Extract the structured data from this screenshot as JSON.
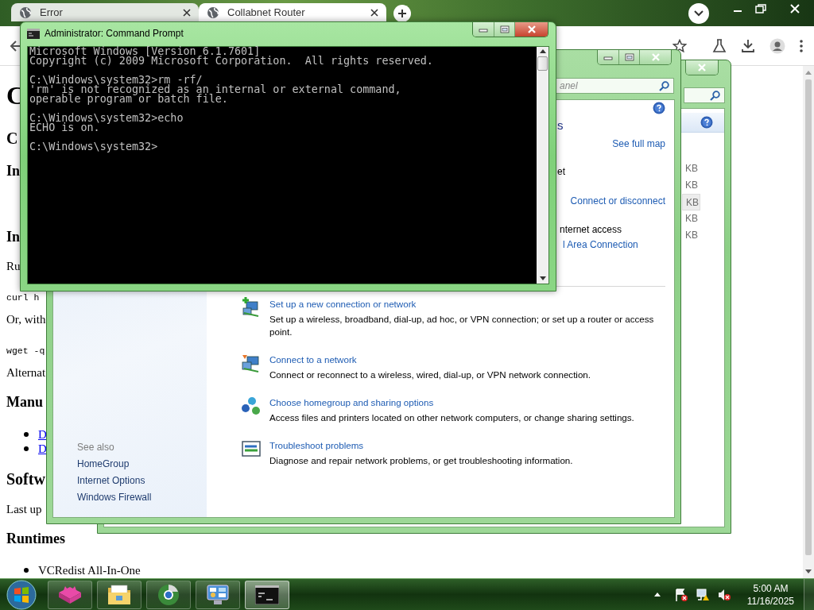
{
  "browser": {
    "tabs": [
      {
        "title": "Error",
        "selected": false
      },
      {
        "title": "Collabnet Router",
        "selected": true
      }
    ],
    "page": [
      {
        "kind": "h1",
        "text": "C"
      },
      {
        "kind": "h2",
        "text": "C"
      },
      {
        "kind": "h3",
        "text": "In"
      },
      {
        "kind": "h3",
        "text": "In"
      },
      {
        "kind": "p",
        "text": "Ru"
      },
      {
        "kind": "code",
        "text": "curl h"
      },
      {
        "kind": "p",
        "text": "Or, with"
      },
      {
        "kind": "code",
        "text": "wget -q"
      },
      {
        "kind": "p",
        "text": "Alternat"
      },
      {
        "kind": "h3",
        "text": "Manu"
      },
      {
        "kind": "link_item",
        "text": "D"
      },
      {
        "kind": "link_item",
        "text": "D"
      },
      {
        "kind": "h2",
        "text": "Softw"
      },
      {
        "kind": "p",
        "text": "Last up"
      },
      {
        "kind": "h3",
        "text": "Runtimes"
      },
      {
        "kind": "item",
        "text": "VCRedist All-In-One"
      }
    ]
  },
  "control_panel_back": {
    "rows": [
      {
        "size": "KB",
        "selected": false
      },
      {
        "size": "KB",
        "selected": false
      },
      {
        "size": "KB",
        "selected": true
      },
      {
        "size": "KB",
        "selected": false
      },
      {
        "size": "KB",
        "selected": false
      }
    ]
  },
  "control_panel": {
    "search": {
      "placeholder": "anel"
    },
    "network_heading": "s",
    "see_full_map": "See full map",
    "network_name": "et",
    "connect_link": "Connect or disconnect",
    "access_type": "nternet access",
    "connection_link": "l Area Connection",
    "tasks": [
      {
        "kind": "new_connection",
        "title": "Set up a new connection or network",
        "description": "Set up a wireless, broadband, dial-up, ad hoc, or VPN connection; or set up a router or access point."
      },
      {
        "kind": "connect",
        "title": "Connect to a network",
        "description": "Connect or reconnect to a wireless, wired, dial-up, or VPN network connection."
      },
      {
        "kind": "homegroup",
        "title": "Choose homegroup and sharing options",
        "description": "Access files and printers located on other network computers, or change sharing settings."
      },
      {
        "kind": "troubleshoot",
        "title": "Troubleshoot problems",
        "description": "Diagnose and repair network problems, or get troubleshooting information."
      }
    ],
    "see_also": {
      "heading": "See also",
      "links": [
        "HomeGroup",
        "Internet Options",
        "Windows Firewall"
      ]
    }
  },
  "command_prompt": {
    "title": "Administrator: Command Prompt",
    "blocks": [
      [
        "Microsoft Windows [Version 6.1.7601]",
        "Copyright (c) 2009 Microsoft Corporation.  All rights reserved."
      ],
      [
        "C:\\Windows\\system32>rm -rf/",
        "'rm' is not recognized as an internal or external command,",
        "operable program or batch file."
      ],
      [
        "C:\\Windows\\system32>echo",
        "ECHO is on."
      ],
      [
        "C:\\Windows\\system32>"
      ]
    ]
  },
  "taskbar": {
    "apps": [
      {
        "kind": "cat",
        "active": false
      },
      {
        "kind": "folder",
        "active": false
      },
      {
        "kind": "browser",
        "active": false
      },
      {
        "kind": "control_panel",
        "active": false
      },
      {
        "kind": "console",
        "active": true
      }
    ],
    "time": "5:00 AM",
    "date": "11/16/2025"
  }
}
